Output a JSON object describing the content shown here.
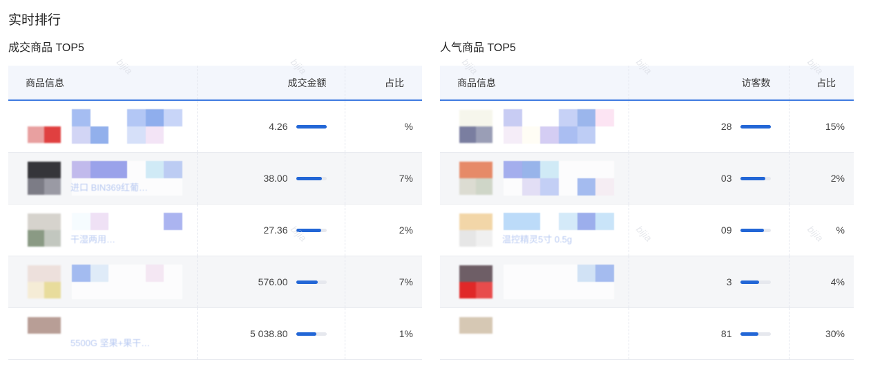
{
  "page_title": "实时排行",
  "watermark_text": "bijia",
  "left_panel": {
    "title": "成交商品 TOP5",
    "columns": {
      "info": "商品信息",
      "value": "成交金额",
      "share": "占比"
    },
    "rows": [
      {
        "name": "",
        "value": "4.26",
        "bar_fraction": 1.0,
        "share": "%",
        "thumb_colors": [
          "#ffffff",
          "#ffffff",
          "#e8a0a0",
          "#e04040"
        ],
        "block_colors": [
          "#88a8ee",
          "#ffffff",
          "#ffffff",
          "#9ab5f2",
          "#6a94e8",
          "#b6c8f6",
          "#c3c8f2",
          "#6e96e6",
          "#ffffff",
          "#c9d6f7",
          "#f0dcf4",
          "#ffffff"
        ]
      },
      {
        "name": "进口 BIN369红葡…",
        "value": "38.00",
        "bar_fraction": 0.86,
        "share": "7%",
        "thumb_colors": [
          "#35353a",
          "#35353a",
          "#7c7c86",
          "#9a9aa4"
        ],
        "block_colors": [
          "#b0a6e8",
          "#7c86e6",
          "#7c86e6",
          "#ffffff",
          "#c4e6f6",
          "#a9bff2",
          "#ffffff",
          "#ffffff",
          "#ffffff",
          "#ffffff",
          "#ffffff",
          "#ffffff"
        ]
      },
      {
        "name": "干湿两用…",
        "value": "27.36",
        "bar_fraction": 0.82,
        "share": "2%",
        "thumb_colors": [
          "#d6d3cd",
          "#d6d3cd",
          "#8a9a84",
          "#c2c7bf"
        ],
        "block_colors": [
          "#f4fbff",
          "#ead7f2",
          "#ffffff",
          "#ffffff",
          "#ffffff",
          "#8f9cec",
          "#ffffff",
          "#ffffff",
          "#ffffff",
          "#ffffff",
          "#ffffff",
          "#ffffff"
        ]
      },
      {
        "name": "",
        "value": "576.00",
        "bar_fraction": 0.72,
        "share": "7%",
        "thumb_colors": [
          "#ede0dc",
          "#ede0dc",
          "#f5ecd6",
          "#e8dc9c"
        ],
        "block_colors": [
          "#88a8ee",
          "#d8e8f8",
          "#ffffff",
          "#ffffff",
          "#f4e2f2",
          "#ffffff",
          "#ffffff",
          "#ffffff",
          "#ffffff",
          "#ffffff",
          "#ffffff",
          "#ffffff"
        ]
      },
      {
        "name": "5500G 坚果+果干…",
        "value": "5 038.80",
        "bar_fraction": 0.66,
        "share": "1%",
        "thumb_colors": [
          "#b89e96",
          "#b89e96",
          "#ffffff",
          "#ffffff"
        ],
        "block_colors": [
          "#ffffff",
          "#ffffff",
          "#ffffff",
          "#ffffff",
          "#ffffff",
          "#ffffff",
          "#ffffff",
          "#ffffff",
          "#ffffff",
          "#ffffff",
          "#ffffff",
          "#ffffff"
        ]
      }
    ]
  },
  "right_panel": {
    "title": "人气商品 TOP5",
    "columns": {
      "info": "商品信息",
      "value": "访客数",
      "share": "占比"
    },
    "rows": [
      {
        "name": "",
        "value": "28",
        "bar_fraction": 1.0,
        "share": "15%",
        "thumb_colors": [
          "#f6f6ec",
          "#f6f6ec",
          "#7a7ea0",
          "#9a9eb6"
        ],
        "block_colors": [
          "#b6bcf0",
          "#ffffff",
          "#ffffff",
          "#b3c2f4",
          "#7a9ee6",
          "#fbdbef",
          "#f2e8f6",
          "#fffdf2",
          "#c6bdef",
          "#8ea9ee",
          "#a9bdf2",
          "#ffffff"
        ]
      },
      {
        "name": "",
        "value": "03",
        "bar_fraction": 0.82,
        "share": "2%",
        "thumb_colors": [
          "#e68a68",
          "#e68a68",
          "#dcdcd2",
          "#cfd6c8"
        ],
        "block_colors": [
          "#8a96ea",
          "#7a9ee6",
          "#c4e6f6",
          "#ffffff",
          "#ffffff",
          "#ffffff",
          "#ffffff",
          "#dcd6f4",
          "#b3c2f4",
          "#ffffff",
          "#8aa8ec",
          "#f6eaf2"
        ]
      },
      {
        "name": "温控精灵5寸 0.5g",
        "value": "09",
        "bar_fraction": 0.78,
        "share": "%",
        "thumb_colors": [
          "#f2d6a8",
          "#f2d6a8",
          "#e6e6e6",
          "#f0f0f0"
        ],
        "block_colors": [
          "#a6d0f8",
          "#a6d0f8",
          "#ffffff",
          "#c6e4f8",
          "#7c94e6",
          "#b8dcf8",
          "#ffffff",
          "#ffffff",
          "#ffffff",
          "#ffffff",
          "#ffffff",
          "#ffffff"
        ]
      },
      {
        "name": "",
        "value": "3",
        "bar_fraction": 0.62,
        "share": "4%",
        "thumb_colors": [
          "#6e5e66",
          "#6e5e66",
          "#e02828",
          "#e84c4c"
        ],
        "block_colors": [
          "#ffffff",
          "#ffffff",
          "#ffffff",
          "#ffffff",
          "#c6dcf4",
          "#8aa8ec",
          "#ffffff",
          "#ffffff",
          "#ffffff",
          "#ffffff",
          "#ffffff",
          "#ffffff"
        ]
      },
      {
        "name": "",
        "value": "81",
        "bar_fraction": 0.6,
        "share": "30%",
        "thumb_colors": [
          "#d6c8b4",
          "#d6c8b4",
          "#ffffff",
          "#ffffff"
        ],
        "block_colors": [
          "#ffffff",
          "#ffffff",
          "#ffffff",
          "#ffffff",
          "#ffffff",
          "#ffffff",
          "#ffffff",
          "#ffffff",
          "#ffffff",
          "#ffffff",
          "#ffffff",
          "#ffffff"
        ]
      }
    ]
  }
}
